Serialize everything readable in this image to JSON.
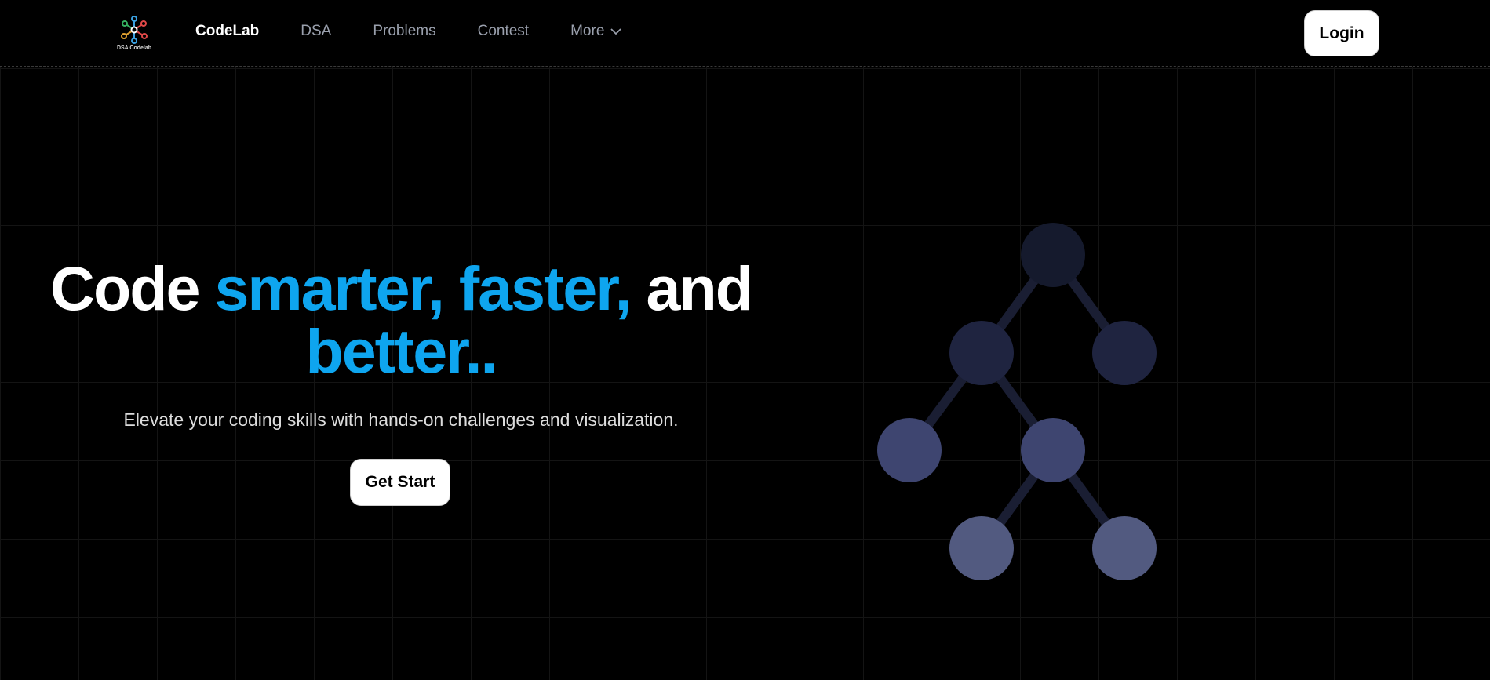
{
  "brand": {
    "logo_text": "DSA Codelab"
  },
  "nav": {
    "items": [
      {
        "label": "CodeLab",
        "active": true
      },
      {
        "label": "DSA",
        "active": false
      },
      {
        "label": "Problems",
        "active": false
      },
      {
        "label": "Contest",
        "active": false
      },
      {
        "label": "More",
        "active": false
      }
    ]
  },
  "header": {
    "login_label": "Login"
  },
  "hero": {
    "title_part1": "Code ",
    "title_accent": "smarter, faster,",
    "title_part2": " and",
    "title_accent2": "better..",
    "subtitle": "Elevate your coding skills with hands-on challenges and visualization.",
    "cta_label": "Get Start"
  },
  "colors": {
    "background": "#000000",
    "accent": "#0ea5ef",
    "nav_text": "#9aa0ad",
    "button_bg": "#ffffff",
    "tree_node_top": "#151a2d",
    "tree_node_mid": "#1f2440",
    "tree_node_low": "#3e4570",
    "tree_node_bottom": "#525a80",
    "tree_edge": "#1a1e33"
  },
  "icons": {
    "logo": "network-graph-icon",
    "more": "chevron-down-icon"
  }
}
